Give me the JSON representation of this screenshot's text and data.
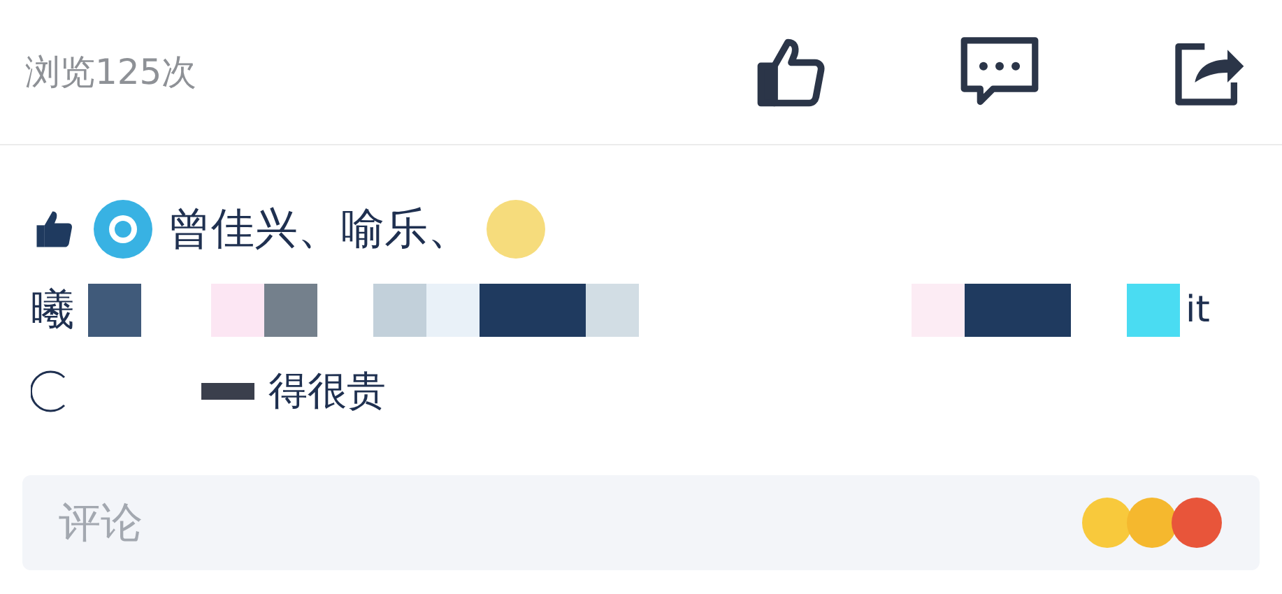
{
  "stats": {
    "views": "浏览125次"
  },
  "likes": {
    "names": "曾佳兴、喻乐、",
    "line_2_start": "曦",
    "line_2_end": "it",
    "line_3_end": "得很贵"
  },
  "comment_field": {
    "placeholder": "评论"
  }
}
